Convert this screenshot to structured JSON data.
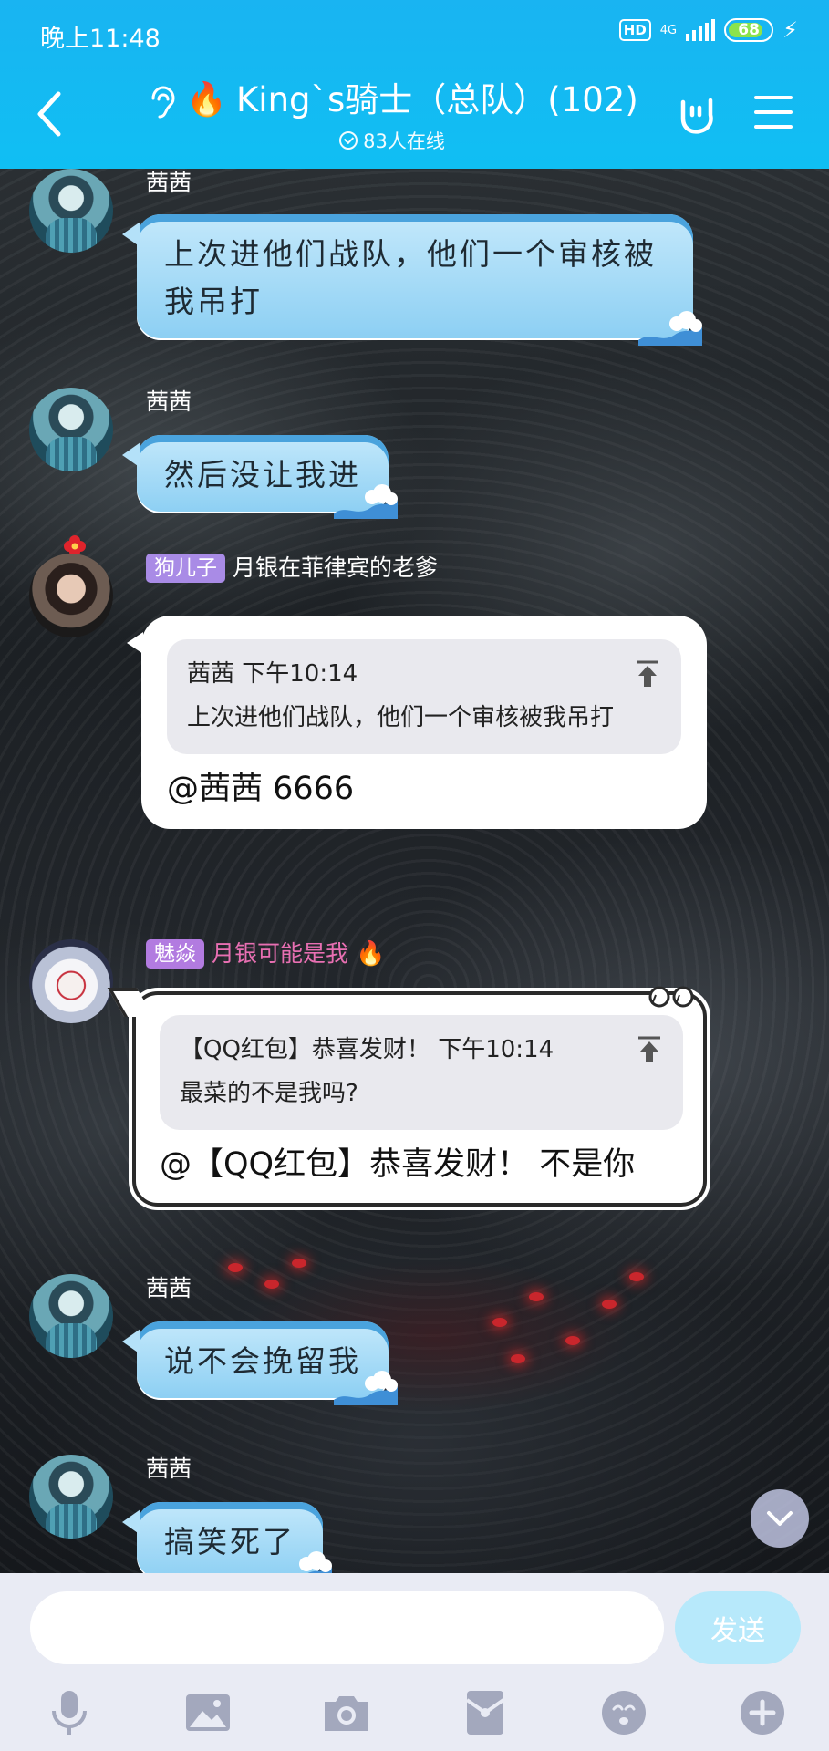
{
  "status_bar": {
    "time": "晚上11:48",
    "hd": "HD",
    "network": "4G",
    "battery": "68"
  },
  "header": {
    "title": "King`s骑士（总队）(102)",
    "online": "83人在线",
    "icons": [
      "back-icon",
      "ear-icon",
      "flame-icon",
      "rock-hand-icon",
      "menu-icon"
    ]
  },
  "messages": [
    {
      "sender": "茜茜",
      "text": "上次进他们战队，他们一个审核被我吊打"
    },
    {
      "sender": "茜茜",
      "text": "然后没让我进"
    },
    {
      "sender": "月银在菲律宾的老爹",
      "tag": "狗儿子",
      "quote_head": "茜茜 下午10:14",
      "quote_text": "上次进他们战队，他们一个审核被我吊打",
      "reply": "@茜茜 6666"
    },
    {
      "sender": "月银可能是我",
      "tag": "魅焱",
      "quote_head": "【QQ红包】恭喜发财！ 下午10:14",
      "quote_text": "最菜的不是我吗?",
      "reply": "@【QQ红包】恭喜发财！ 不是你"
    },
    {
      "sender": "茜茜",
      "text": "说不会挽留我"
    },
    {
      "sender": "茜茜",
      "text": "搞笑死了"
    }
  ],
  "composer": {
    "placeholder": "",
    "send_label": "发送"
  },
  "toolbar_icons": [
    "microphone-icon",
    "image-icon",
    "camera-icon",
    "red-packet-icon",
    "emoji-icon",
    "plus-icon"
  ],
  "colors": {
    "header": "#19b4f2",
    "bubble_blue": "#8ccff3",
    "tag_purple": "#a98be6",
    "send_disabled": "#b7e9fb"
  }
}
